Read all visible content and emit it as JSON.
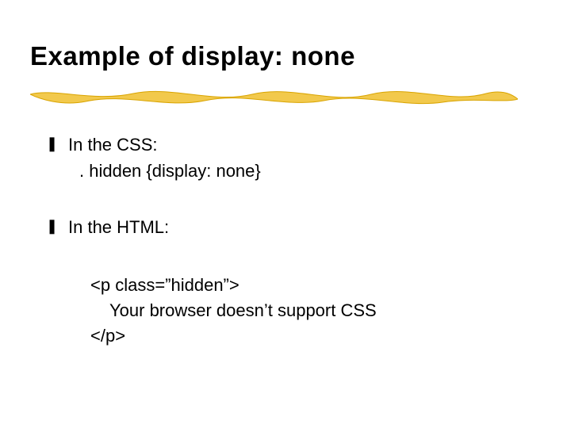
{
  "slide": {
    "title": "Example of display: none",
    "bullets": [
      {
        "label": "In the CSS:",
        "sub": ". hidden {display: none}"
      },
      {
        "label": "In the HTML:"
      }
    ],
    "code": {
      "open": "<p class=”hidden”>",
      "body": "Your browser doesn’t support CSS",
      "close": "</p>"
    }
  }
}
